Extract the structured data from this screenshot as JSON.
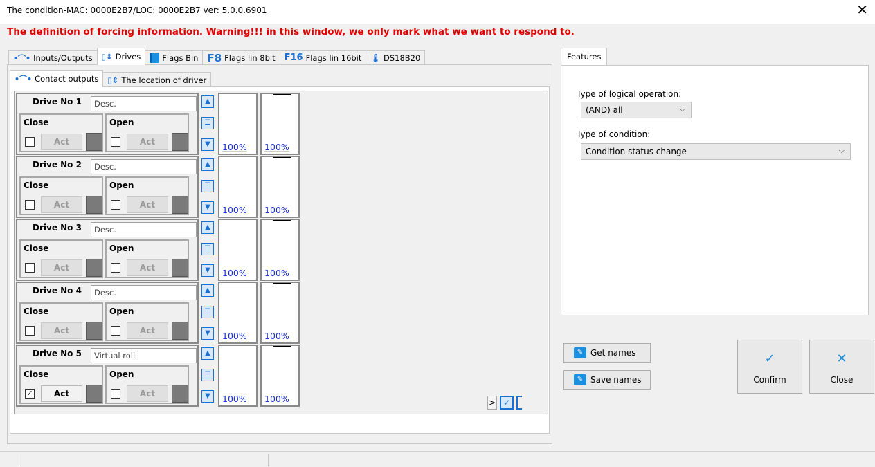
{
  "window": {
    "title": "The condition-MAC: 0000E2B7/LOC: 0000E2B7 ver: 5.0.0.6901"
  },
  "warning": "The definition of forcing information. Warning!!! in this window, we only mark what we want to respond to.",
  "tabs": [
    {
      "label": "Inputs/Outputs",
      "icon": "io-icon"
    },
    {
      "label": "Drives",
      "icon": "drives-icon"
    },
    {
      "label": "Flags Bin",
      "icon": "flag-bin-icon"
    },
    {
      "label": "Flags lin 8bit",
      "icon": "f8-icon",
      "icon_text": "F8"
    },
    {
      "label": "Flags lin 16bit",
      "icon": "f16-icon",
      "icon_text": "F16"
    },
    {
      "label": "DS18B20",
      "icon": "thermometer-icon"
    }
  ],
  "subtabs": [
    {
      "label": "Contact outputs",
      "icon": "io-icon"
    },
    {
      "label": "The location of driver",
      "icon": "drives-icon"
    }
  ],
  "drive_labels": {
    "close": "Close",
    "open": "Open",
    "act": "Act"
  },
  "drives": [
    {
      "name": "Drive No 1",
      "desc": "Desc.",
      "close_checked": false,
      "open_checked": false,
      "bar1": "100%",
      "bar2": "100%"
    },
    {
      "name": "Drive No 2",
      "desc": "Desc.",
      "close_checked": false,
      "open_checked": false,
      "bar1": "100%",
      "bar2": "100%"
    },
    {
      "name": "Drive No 3",
      "desc": "Desc.",
      "close_checked": false,
      "open_checked": false,
      "bar1": "100%",
      "bar2": "100%"
    },
    {
      "name": "Drive No 4",
      "desc": "Desc.",
      "close_checked": false,
      "open_checked": false,
      "bar1": "100%",
      "bar2": "100%"
    },
    {
      "name": "Drive No 5",
      "desc": "Virtual roll",
      "close_checked": true,
      "open_checked": false,
      "bar1": "100%",
      "bar2": "100%"
    }
  ],
  "pager": {
    "next": ">"
  },
  "features": {
    "tab": "Features",
    "logical_label": "Type of logical operation:",
    "logical_value": "(AND) all",
    "condition_label": "Type of condition:",
    "condition_value": "Condition status change"
  },
  "buttons": {
    "get_names": "Get names",
    "save_names": "Save names",
    "confirm": "Confirm",
    "close": "Close"
  },
  "colors": {
    "warning": "#e00000",
    "accent": "#1b6fd1",
    "percent": "#1b2fd1"
  }
}
